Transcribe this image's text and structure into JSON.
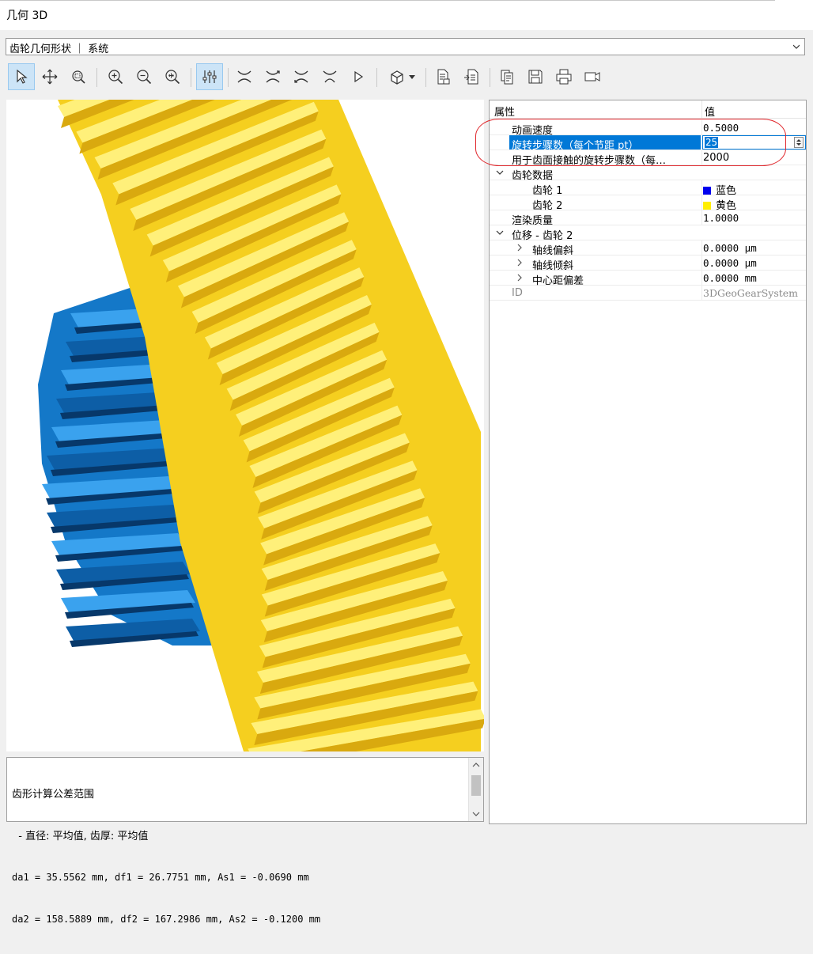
{
  "window": {
    "title": "几何 3D"
  },
  "selector": {
    "value": "齿轮几何形状 ｜ 系统"
  },
  "toolbar": {
    "icons": [
      "select-icon",
      "pan-icon",
      "zoom-window-icon",
      "zoom-in-icon",
      "zoom-out-icon",
      "zoom-fit-icon",
      "settings-sliders-icon",
      "view-1-icon",
      "view-2-icon",
      "view-3-icon",
      "view-4-icon",
      "play-icon",
      "cube-icon",
      "report-icon",
      "export-icon",
      "copy-icon",
      "save-icon",
      "print-icon",
      "video-icon"
    ]
  },
  "log": {
    "lines": [
      "齿形计算公差范围",
      "  - 直径: 平均值, 齿厚: 平均值",
      "da1 = 35.5562 mm, df1 = 26.7751 mm, As1 = -0.0690 mm",
      "da2 = 158.5889 mm, df2 = 167.2986 mm, As2 = -0.1200 mm"
    ]
  },
  "properties": {
    "header": {
      "name": "属性",
      "value": "值"
    },
    "rows": [
      {
        "name": "动画速度",
        "value": "0.5000"
      },
      {
        "name": "旋转步骤数（每个节距 pt）",
        "value": "25"
      },
      {
        "name": "用于齿面接触的旋转步骤数（每…",
        "value": "2000"
      },
      {
        "name": "齿轮数据",
        "value": ""
      },
      {
        "name": "齿轮 1",
        "value": "蓝色"
      },
      {
        "name": "齿轮 2",
        "value": "黄色"
      },
      {
        "name": "渲染质量",
        "value": "1.0000"
      },
      {
        "name": "位移 - 齿轮 2",
        "value": ""
      },
      {
        "name": "轴线偏斜",
        "value": "0.0000 µm"
      },
      {
        "name": "轴线倾斜",
        "value": "0.0000 µm"
      },
      {
        "name": "中心距偏差",
        "value": "0.0000 mm"
      },
      {
        "name": "ID",
        "value": "3DGeoGearSystem"
      }
    ]
  },
  "colors": {
    "gear1": "#1d86d6",
    "gear2": "#ffe500",
    "selection": "#0078d7",
    "annotation": "#e0262b"
  }
}
